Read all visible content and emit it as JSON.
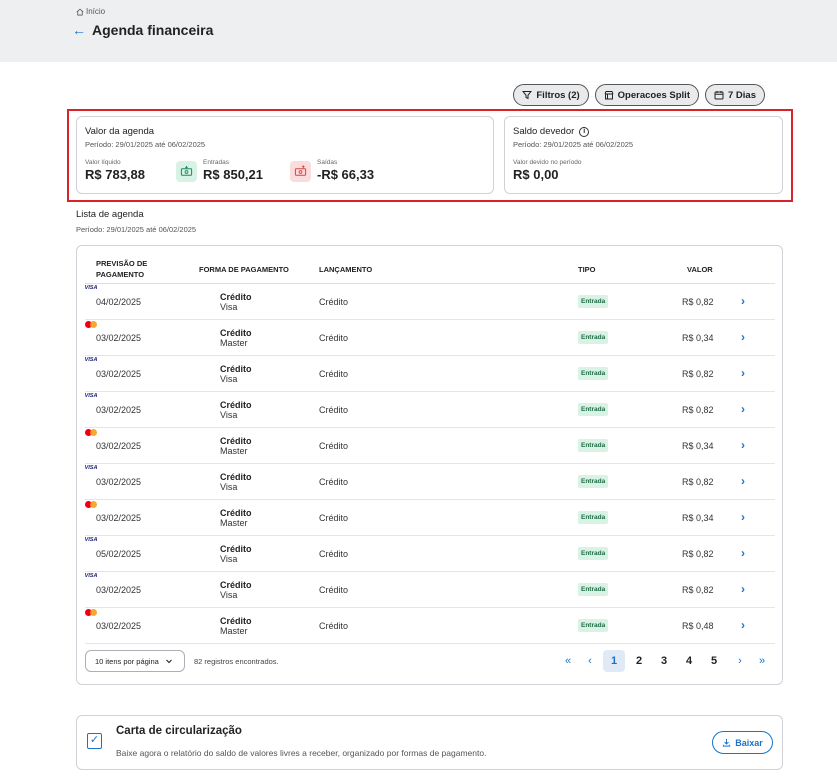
{
  "breadcrumb": {
    "home_label": "Início"
  },
  "page": {
    "title": "Agenda financeira"
  },
  "actions": {
    "filters_label": "Filtros (2)",
    "split_label": "Operacoes Split",
    "days_label": "7 Dias"
  },
  "agenda_value": {
    "title": "Valor da agenda",
    "period": "Período: 29/01/2025 até 06/02/2025",
    "net_label": "Valor líquido",
    "net_value": "R$ 783,88",
    "in_label": "Entradas",
    "in_value": "R$ 850,21",
    "out_label": "Saídas",
    "out_value": "-R$ 66,33"
  },
  "balance_due": {
    "title": "Saldo devedor",
    "period": "Período: 29/01/2025 até 06/02/2025",
    "label": "Valor devido no período",
    "value": "R$ 0,00"
  },
  "list": {
    "title": "Lista de agenda",
    "period": "Período: 29/01/2025 até 06/02/2025",
    "headers": {
      "date_line1": "Previsão de",
      "date_line2": "pagamento",
      "payment": "Forma de pagamento",
      "launch": "Lançamento",
      "type": "Tipo",
      "value": "Valor"
    },
    "rows": [
      {
        "date": "04/02/2025",
        "method": "Crédito",
        "brand": "Visa",
        "brand_logo": "VISA",
        "launch": "Crédito",
        "type": "Entrada",
        "value": "R$ 0,82"
      },
      {
        "date": "03/02/2025",
        "method": "Crédito",
        "brand": "Master",
        "brand_logo": "",
        "launch": "Crédito",
        "type": "Entrada",
        "value": "R$ 0,34"
      },
      {
        "date": "03/02/2025",
        "method": "Crédito",
        "brand": "Visa",
        "brand_logo": "VISA",
        "launch": "Crédito",
        "type": "Entrada",
        "value": "R$ 0,82"
      },
      {
        "date": "03/02/2025",
        "method": "Crédito",
        "brand": "Visa",
        "brand_logo": "VISA",
        "launch": "Crédito",
        "type": "Entrada",
        "value": "R$ 0,82"
      },
      {
        "date": "03/02/2025",
        "method": "Crédito",
        "brand": "Master",
        "brand_logo": "",
        "launch": "Crédito",
        "type": "Entrada",
        "value": "R$ 0,34"
      },
      {
        "date": "03/02/2025",
        "method": "Crédito",
        "brand": "Visa",
        "brand_logo": "VISA",
        "launch": "Crédito",
        "type": "Entrada",
        "value": "R$ 0,82"
      },
      {
        "date": "03/02/2025",
        "method": "Crédito",
        "brand": "Master",
        "brand_logo": "",
        "launch": "Crédito",
        "type": "Entrada",
        "value": "R$ 0,34"
      },
      {
        "date": "05/02/2025",
        "method": "Crédito",
        "brand": "Visa",
        "brand_logo": "VISA",
        "launch": "Crédito",
        "type": "Entrada",
        "value": "R$ 0,82"
      },
      {
        "date": "03/02/2025",
        "method": "Crédito",
        "brand": "Visa",
        "brand_logo": "VISA",
        "launch": "Crédito",
        "type": "Entrada",
        "value": "R$ 0,82"
      },
      {
        "date": "03/02/2025",
        "method": "Crédito",
        "brand": "Master",
        "brand_logo": "",
        "launch": "Crédito",
        "type": "Entrada",
        "value": "R$ 0,48"
      }
    ]
  },
  "pagination": {
    "per_page_label": "10 itens por página",
    "records_label": "82 registros encontrados.",
    "pages": [
      "1",
      "2",
      "3",
      "4",
      "5"
    ],
    "current_page": 1,
    "first_glyph": "«",
    "prev_glyph": "‹",
    "next_glyph": "›",
    "last_glyph": "»"
  },
  "carta": {
    "title": "Carta de circularização",
    "description": "Baixe agora o relatório do saldo de valores livres a receber, organizado por formas de pagamento.",
    "button_label": "Baixar"
  },
  "colors": {
    "accent": "#1a73c9",
    "highlight": "#d8232a",
    "entrada_badge_bg": "#d8f2e6",
    "entrada_badge_text": "#1f6b45"
  }
}
